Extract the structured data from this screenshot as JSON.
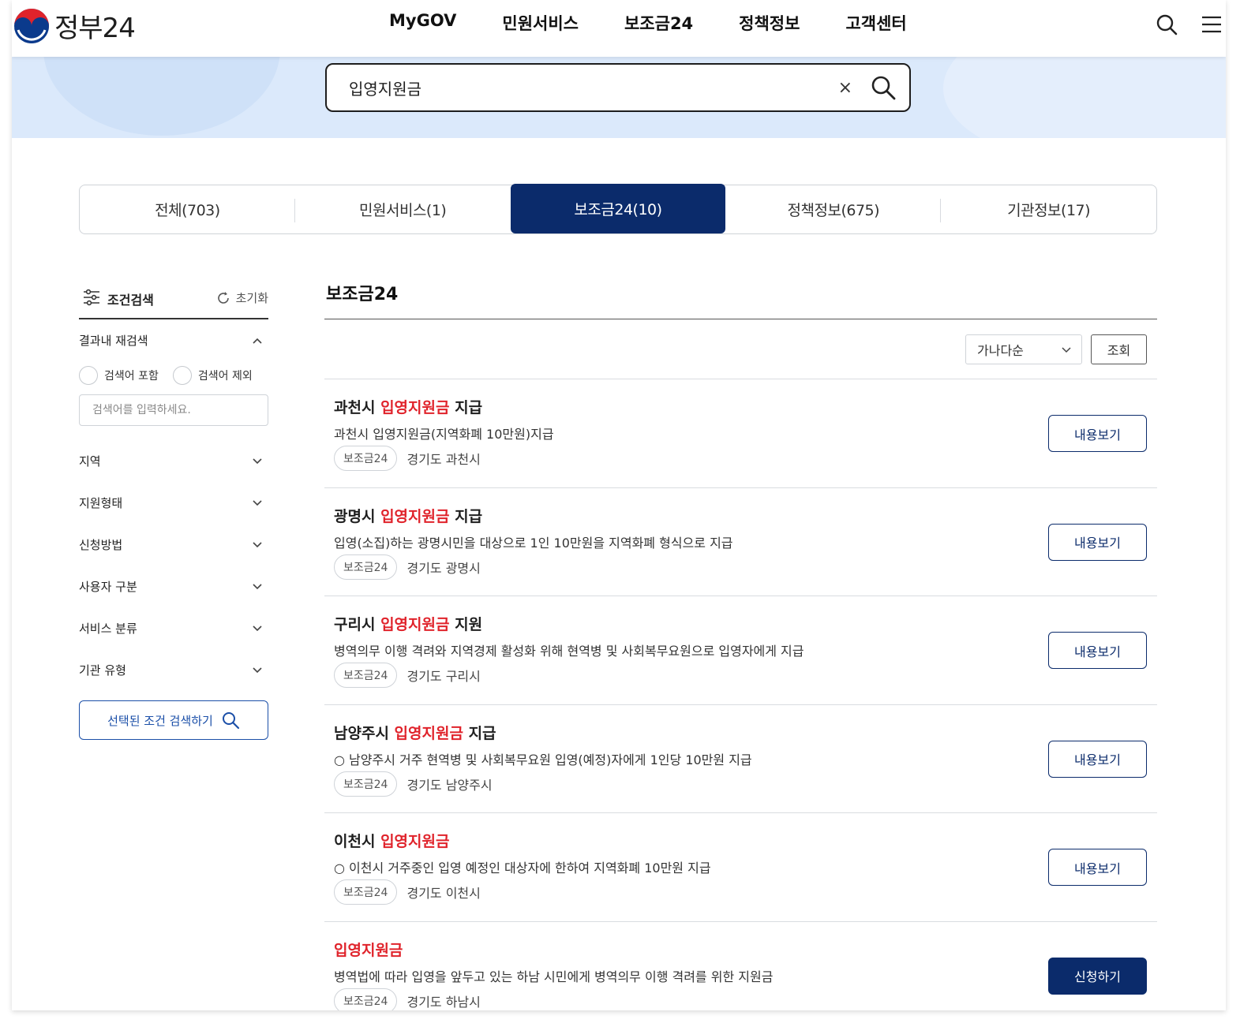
{
  "header": {
    "logo_text": "정부24",
    "nav": [
      "MyGOV",
      "민원서비스",
      "보조금24",
      "정책정보",
      "고객센터"
    ]
  },
  "search": {
    "value": "입영지원금",
    "clear_label": "×"
  },
  "tabs": [
    {
      "label": "전체(703)"
    },
    {
      "label": "민원서비스(1)"
    },
    {
      "label": "보조금24(10)"
    },
    {
      "label": "정책정보(675)"
    },
    {
      "label": "기관정보(17)"
    }
  ],
  "sidebar": {
    "title": "조건검색",
    "reset_label": "초기화",
    "refine_label": "결과내 재검색",
    "radio_include": "검색어 포함",
    "radio_exclude": "검색어 제외",
    "refine_placeholder": "검색어를 입력하세요.",
    "facets": [
      "지역",
      "지원형태",
      "신청방법",
      "사용자 구분",
      "서비스 분류",
      "기관 유형"
    ],
    "search_button": "선택된 조건 검색하기"
  },
  "main": {
    "title": "보조금24",
    "sort_selected": "가나다순",
    "sort_button": "조회",
    "items": [
      {
        "prefix": "과천시 ",
        "highlight": "입영지원금",
        "suffix": " 지급",
        "desc": "과천시 입영지원금(지역화폐 10만원)지급",
        "badge": "보조금24",
        "region": "경기도 과천시",
        "button": "내용보기"
      },
      {
        "prefix": "광명시 ",
        "highlight": "입영지원금",
        "suffix": " 지급",
        "desc": "입영(소집)하는 광명시민을 대상으로 1인 10만원을 지역화폐 형식으로 지급",
        "badge": "보조금24",
        "region": "경기도 광명시",
        "button": "내용보기"
      },
      {
        "prefix": "구리시 ",
        "highlight": "입영지원금",
        "suffix": " 지원",
        "desc": "병역의무 이행 격려와 지역경제 활성화 위해 현역병 및 사회복무요원으로 입영자에게 지급",
        "badge": "보조금24",
        "region": "경기도 구리시",
        "button": "내용보기"
      },
      {
        "prefix": "남양주시 ",
        "highlight": "입영지원금",
        "suffix": " 지급",
        "desc": "○ 남양주시 거주 현역병 및 사회복무요원 입영(예정)자에게 1인당 10만원 지급",
        "badge": "보조금24",
        "region": "경기도 남양주시",
        "button": "내용보기"
      },
      {
        "prefix": "이천시 ",
        "highlight": "입영지원금",
        "suffix": "",
        "desc": "○ 이천시 거주중인 입영 예정인 대상자에 한하여 지역화폐 10만원 지급",
        "badge": "보조금24",
        "region": "경기도 이천시",
        "button": "내용보기"
      },
      {
        "prefix": "",
        "highlight": "입영지원금",
        "suffix": "",
        "desc": "병역법에 따라 입영을 앞두고 있는 하남 시민에게 병역의무 이행 격려를 위한 지원금",
        "badge": "보조금24",
        "region": "경기도 하남시",
        "button": "신청하기"
      }
    ]
  },
  "colors": {
    "primary": "#0b2b6b",
    "highlight": "#e0232b",
    "band": "#dbe9fb"
  }
}
